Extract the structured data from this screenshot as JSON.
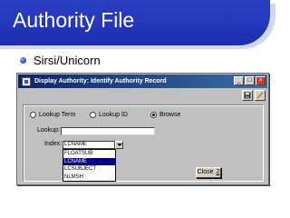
{
  "slide": {
    "title": "Authority File",
    "bullet": "Sirsi/Unicorn",
    "colors": {
      "header": "#2c3fc4",
      "header_shadow": "#cfd8f3"
    }
  },
  "window": {
    "title": "Display Authority: Identify Authority Record",
    "titlebar_buttons": [
      "minimize-icon",
      "maximize-icon",
      "close-icon"
    ],
    "toolbar_icons": [
      "save-disk-icon",
      "edit-pencil-icon"
    ],
    "search_type": {
      "options": [
        "Lookup Term",
        "Lookup ID",
        "Browse"
      ],
      "selected": "Browse"
    },
    "lookup": {
      "label": "Lookup:",
      "value": ""
    },
    "index": {
      "label": "Index:",
      "selected": "LCNAME",
      "options": [
        "FLOATSUB",
        "LCNAME",
        "LCSUBJECT",
        "NLMSH"
      ],
      "highlighted": "LCNAME"
    },
    "close_button": {
      "label": "Close",
      "shortcut": "2"
    }
  }
}
